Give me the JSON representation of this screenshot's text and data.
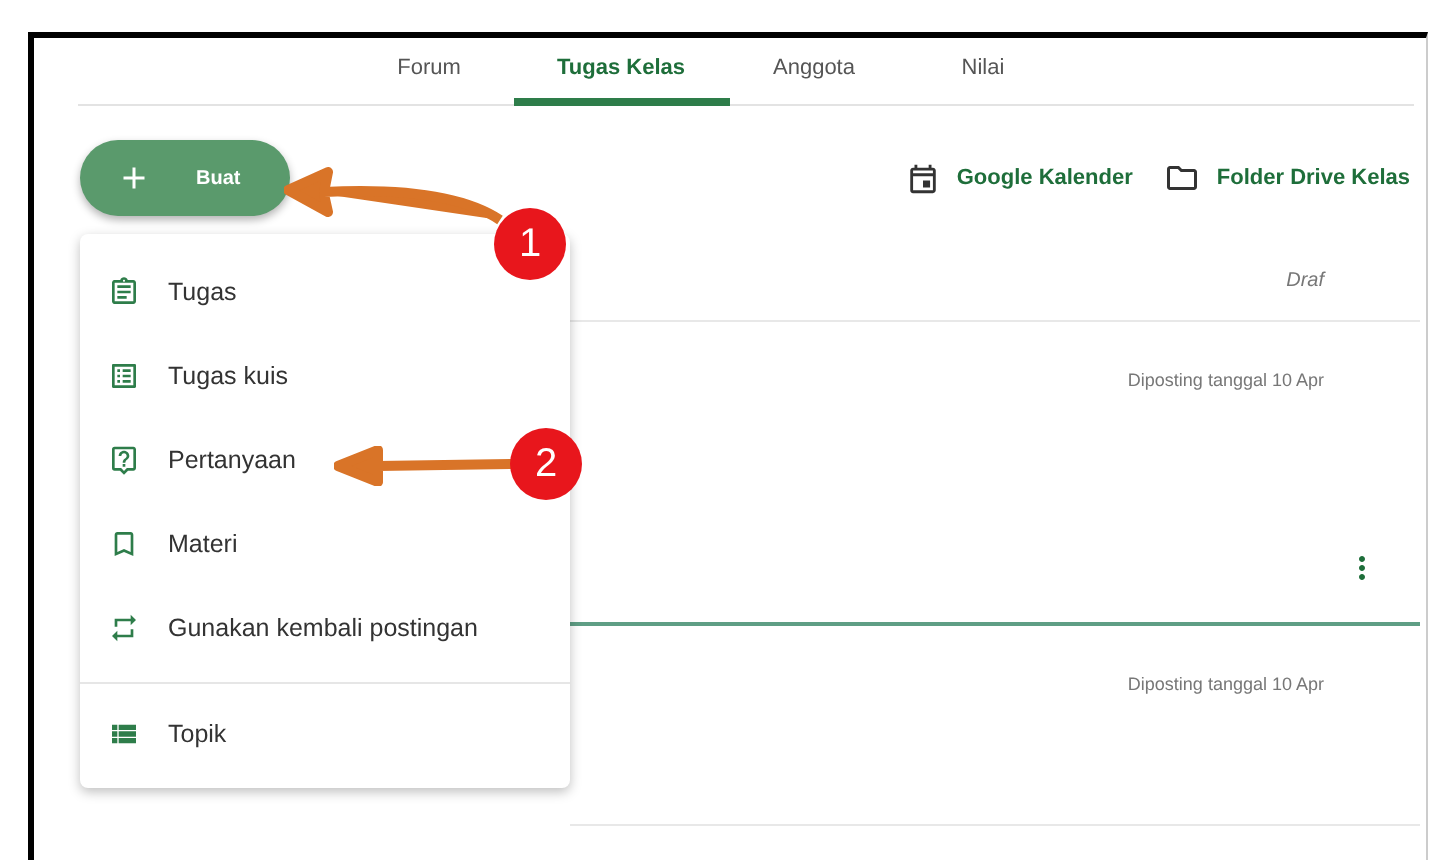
{
  "tabs": [
    {
      "label": "Forum",
      "selected": false
    },
    {
      "label": "Tugas Kelas",
      "selected": true
    },
    {
      "label": "Anggota",
      "selected": false
    },
    {
      "label": "Nilai",
      "selected": false
    }
  ],
  "create_button": {
    "label": "Buat"
  },
  "links": [
    {
      "kind": "calendar",
      "label": "Google Kalender"
    },
    {
      "kind": "folder",
      "label": "Folder Drive Kelas"
    }
  ],
  "create_menu": {
    "items": [
      {
        "kind": "assignment",
        "label": "Tugas"
      },
      {
        "kind": "quiz",
        "label": "Tugas kuis"
      },
      {
        "kind": "question",
        "label": "Pertanyaan"
      },
      {
        "kind": "material",
        "label": "Materi"
      },
      {
        "kind": "reuse",
        "label": "Gunakan kembali postingan"
      }
    ],
    "footer_items": [
      {
        "kind": "topic",
        "label": "Topik"
      }
    ]
  },
  "posts": [
    {
      "status": "Draf",
      "draft": true,
      "has_menu": false,
      "selected": false
    },
    {
      "status": "Diposting tanggal 10 Apr",
      "draft": false,
      "has_menu": true,
      "selected": true
    },
    {
      "status": "Diposting tanggal 10 Apr",
      "draft": false,
      "has_menu": false,
      "selected": false
    }
  ],
  "callouts": [
    {
      "number": "1"
    },
    {
      "number": "2"
    }
  ]
}
